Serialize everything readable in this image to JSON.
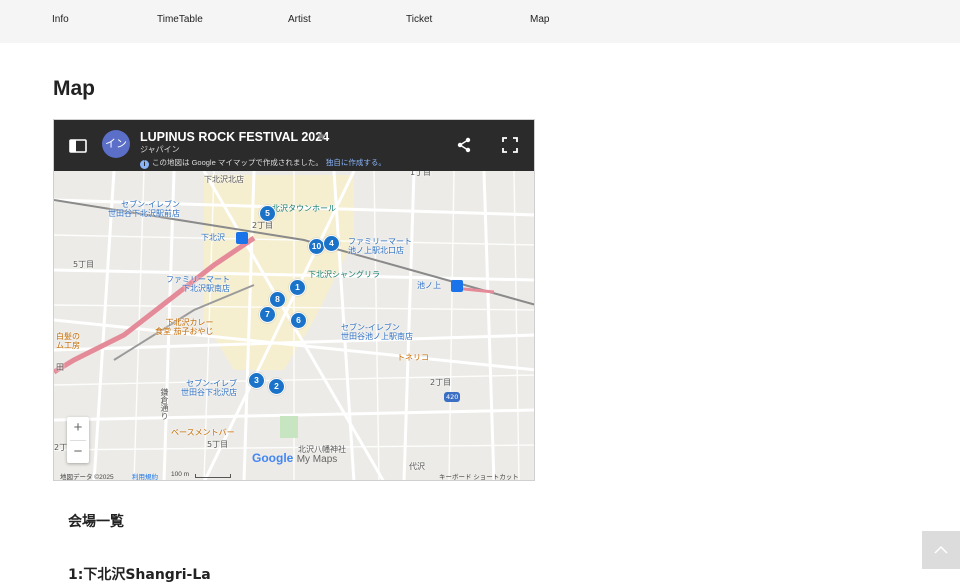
{
  "nav": {
    "items": [
      "Info",
      "TimeTable",
      "Artist",
      "Ticket",
      "Map"
    ]
  },
  "page_title": "Map",
  "map": {
    "title": "LUPINUS ROCK FESTIVAL 2024",
    "author": "ジャパイン",
    "avatar_text": "イン",
    "info_text": "この地図は Google マイマップで作成されました。",
    "create_link": "独自に作成する。",
    "footer": {
      "data_label": "地図データ ©2025",
      "terms": "利用規約",
      "scale": "100 m",
      "shortcuts": "キーボード ショートカット"
    },
    "google_logo": "Google",
    "mymaps_label": "My Maps",
    "zoom_in": "+",
    "zoom_out": "−",
    "pins": [
      "5",
      "10",
      "4",
      "1",
      "8",
      "7",
      "6",
      "3",
      "2"
    ],
    "labels": {
      "seven_shimo_kita_eki_mae": "セブン-イレブン\n世田谷下北沢駅前店",
      "shimokitazawa": "下北沢",
      "kitazawa_town_hall": "北沢タウンホール",
      "familymart_ikenoue": "ファミリーマート\n池ノ上駅北口店",
      "shimokita_shangrila": "下北沢シャングリラ",
      "familymart_minami": "ファミリーマート\n下北沢駅南店",
      "ikenoue": "池ノ上",
      "shimokita_curry": "下北沢カレー\n食堂 茄子おやじ",
      "seven_ikenoue_minami": "セブン-イレブン\n世田谷池ノ上駅南店",
      "shiragami": "白髪の\nム工房",
      "torinico": "トネリコ",
      "chome5_top": "5丁目",
      "chome2_top": "2丁目",
      "chome1_top": "1丁目",
      "chome2_right": "2丁目",
      "chome5_bottom": "5丁目",
      "chome2_left": "2丁",
      "seven_shimokita_minami": "セブン-イレブ\n世田谷下北沢店",
      "basement_bar": "ベースメントバー",
      "kamata_dori": "鎌倉通り",
      "kitazawa_shrine": "北沢八幡神社",
      "daita": "代沢",
      "route_420": "420",
      "shimo_top": "下北沢北店",
      "ta": "田"
    }
  },
  "section_heading": "会場一覧",
  "venue_heading": "1:下北沢Shangri-La",
  "scroll_top_label": "︿"
}
